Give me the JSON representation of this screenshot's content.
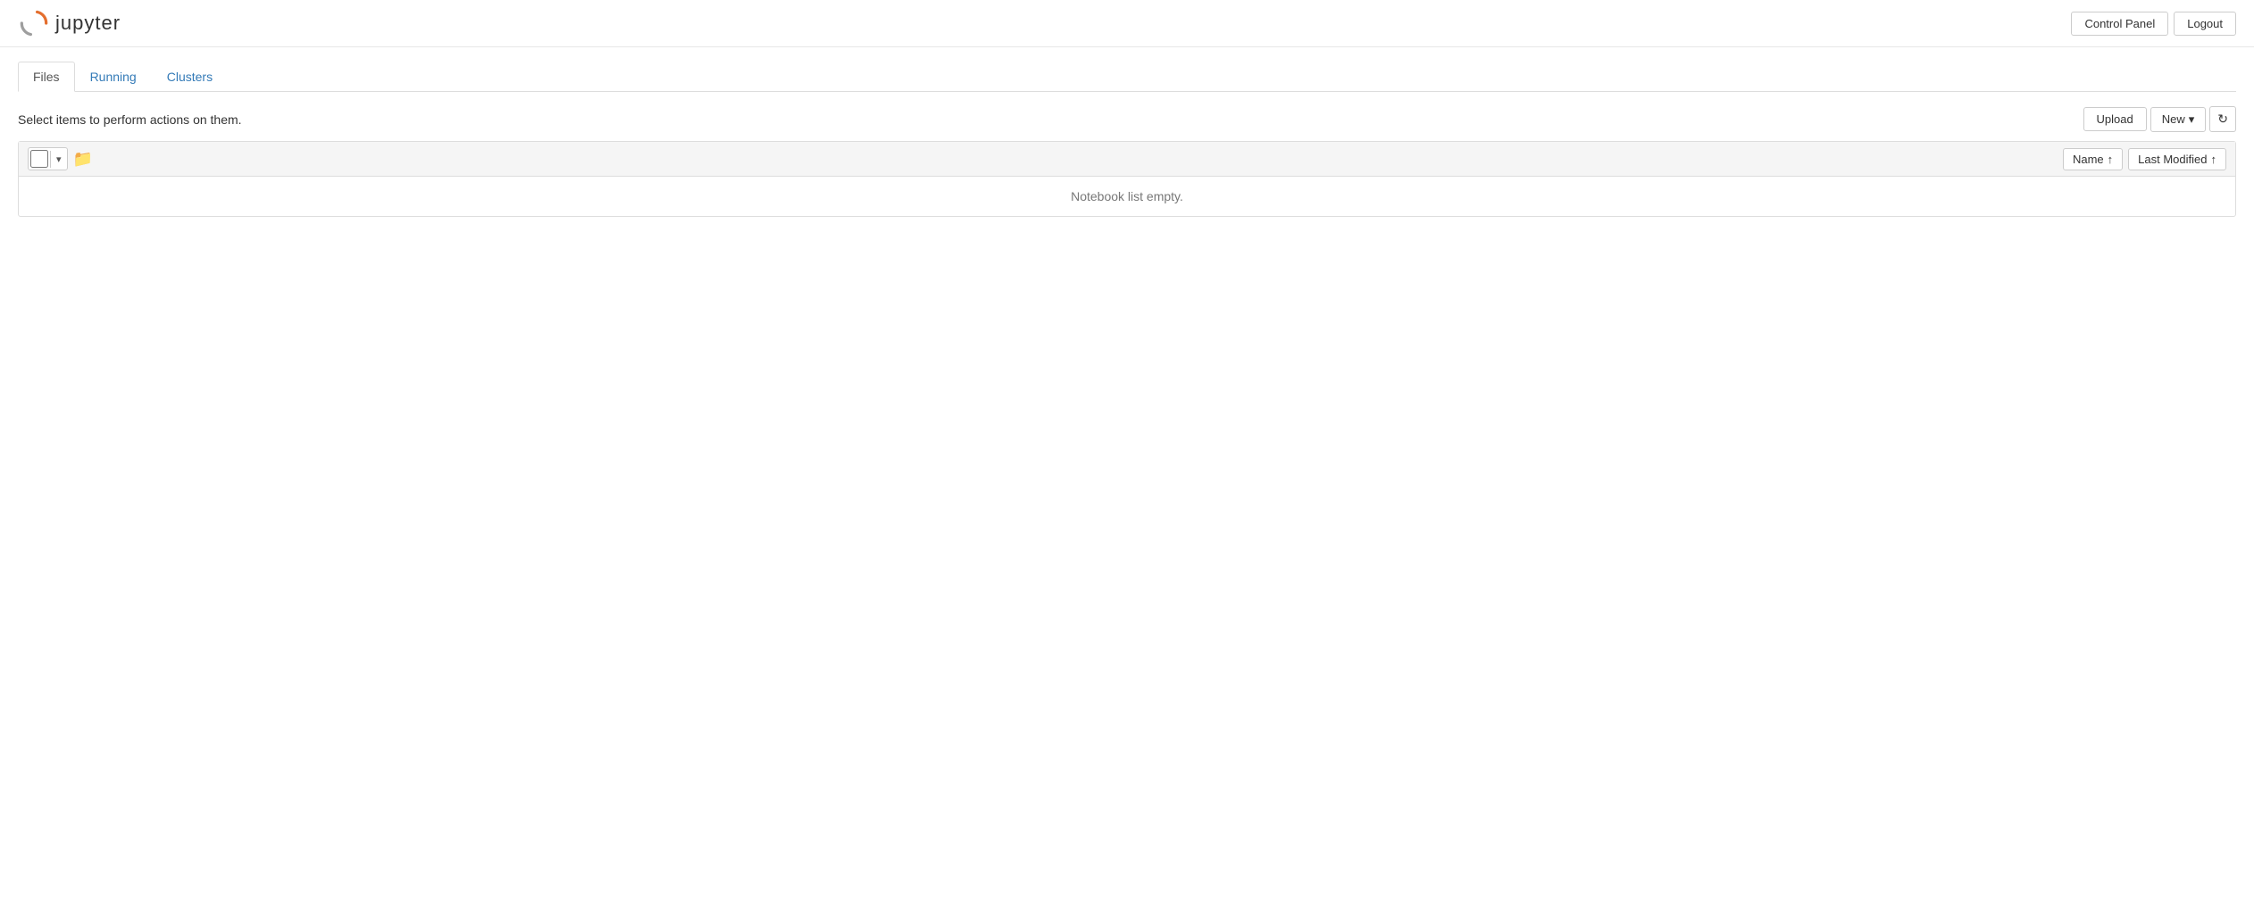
{
  "header": {
    "logo_text": "jupyter",
    "control_panel_label": "Control Panel",
    "logout_label": "Logout"
  },
  "tabs": [
    {
      "id": "files",
      "label": "Files",
      "active": true
    },
    {
      "id": "running",
      "label": "Running",
      "active": false
    },
    {
      "id": "clusters",
      "label": "Clusters",
      "active": false
    }
  ],
  "toolbar": {
    "select_text": "Select items to perform actions on them.",
    "upload_label": "Upload",
    "new_label": "New",
    "refresh_icon": "↻"
  },
  "file_browser": {
    "name_sort_label": "Name",
    "last_modified_label": "Last Modified",
    "empty_message": "Notebook list empty."
  }
}
